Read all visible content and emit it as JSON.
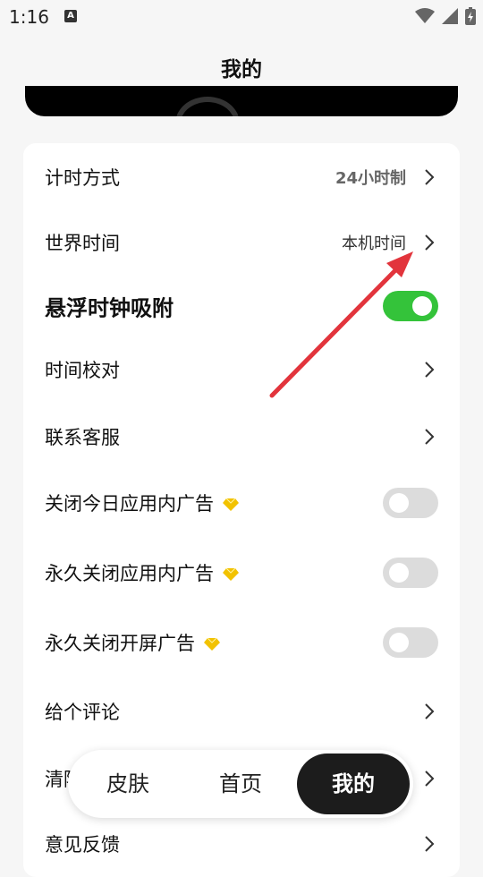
{
  "status": {
    "time": "1:16",
    "notify_letter": "A"
  },
  "header": {
    "title": "我的"
  },
  "settings": {
    "time_format": {
      "label": "计时方式",
      "value": "24小时制"
    },
    "world_time": {
      "label": "世界时间",
      "value": "本机时间"
    },
    "float_clock": {
      "label": "悬浮时钟吸附",
      "toggle": "on"
    },
    "time_calibration": {
      "label": "时间校对"
    },
    "contact_support": {
      "label": "联系客服"
    },
    "close_today_ads": {
      "label": "关闭今日应用内广告",
      "toggle": "off"
    },
    "close_forever_ads": {
      "label": "永久关闭应用内广告",
      "toggle": "off"
    },
    "close_splash_ads": {
      "label": "永久关闭开屏广告",
      "toggle": "off"
    },
    "rate": {
      "label": "给个评论"
    },
    "clear_partial": {
      "label": "清除"
    },
    "feedback": {
      "label": "意见反馈"
    }
  },
  "tabs": [
    {
      "label": "皮肤"
    },
    {
      "label": "首页"
    },
    {
      "label": "我的",
      "active": true
    }
  ],
  "colors": {
    "toggle_on": "#34c33a",
    "toggle_off": "#dcdcdc",
    "arrow": "#e2343c",
    "gem": "#f2c200"
  }
}
